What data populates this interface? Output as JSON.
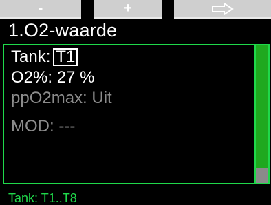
{
  "softkeys": {
    "left_label": "-",
    "middle_label": "+",
    "right_icon": "arrow-right-outline-icon"
  },
  "screen_title": "1.O2-waarde",
  "settings": {
    "tank_label": "Tank:",
    "tank_value": "T1",
    "o2_label": "O2%:",
    "o2_value": "27 %",
    "ppo2max_label": "ppO2max:",
    "ppo2max_value": "Uit",
    "mod_label": "MOD:",
    "mod_value": "---"
  },
  "hint_text": "Tank: T1..T8",
  "colors": {
    "accent_green": "#1fd84a",
    "scroll_green": "#1fa81f",
    "softkey_gray": "#cfcfcf",
    "dim_text": "#8c8c8c"
  }
}
